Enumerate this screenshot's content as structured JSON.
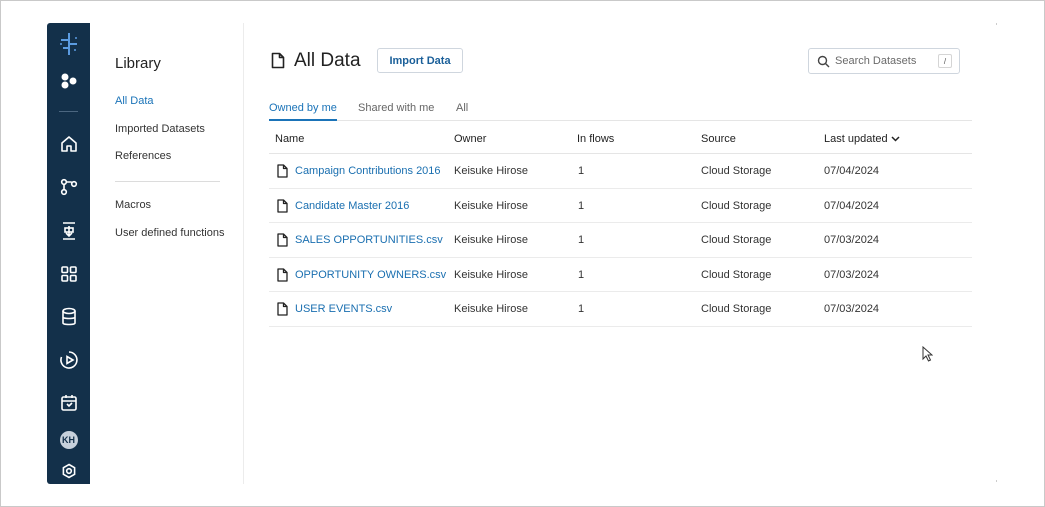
{
  "sidebar": {
    "icons": [
      "logo-icon",
      "apps-icon",
      "home-icon",
      "flow-icon",
      "transform-icon",
      "grid-icon",
      "database-icon",
      "play-icon",
      "schedule-icon",
      "avatar",
      "settings-icon"
    ],
    "avatar_initials": "KH"
  },
  "library": {
    "title": "Library",
    "items": [
      {
        "label": "All Data",
        "active": true
      },
      {
        "label": "Imported Datasets",
        "active": false
      },
      {
        "label": "References",
        "active": false
      }
    ],
    "items2": [
      {
        "label": "Macros"
      },
      {
        "label": "User defined functions"
      }
    ]
  },
  "header": {
    "title": "All Data",
    "import_label": "Import Data",
    "search_placeholder": "Search Datasets",
    "search_shortcut": "/"
  },
  "tabs": [
    {
      "label": "Owned by me",
      "active": true
    },
    {
      "label": "Shared with me",
      "active": false
    },
    {
      "label": "All",
      "active": false
    }
  ],
  "table": {
    "columns": [
      "Name",
      "Owner",
      "In flows",
      "Source",
      "Last updated"
    ],
    "rows": [
      {
        "name": "Campaign Contributions 2016",
        "owner": "Keisuke Hirose",
        "flows": "1",
        "source": "Cloud Storage",
        "updated": "07/04/2024"
      },
      {
        "name": "Candidate Master 2016",
        "owner": "Keisuke Hirose",
        "flows": "1",
        "source": "Cloud Storage",
        "updated": "07/04/2024"
      },
      {
        "name": "SALES OPPORTUNITIES.csv",
        "owner": "Keisuke Hirose",
        "flows": "1",
        "source": "Cloud Storage",
        "updated": "07/03/2024"
      },
      {
        "name": "OPPORTUNITY OWNERS.csv",
        "owner": "Keisuke Hirose",
        "flows": "1",
        "source": "Cloud Storage",
        "updated": "07/03/2024"
      },
      {
        "name": "USER EVENTS.csv",
        "owner": "Keisuke Hirose",
        "flows": "1",
        "source": "Cloud Storage",
        "updated": "07/03/2024"
      }
    ]
  },
  "colors": {
    "accent": "#1a73b8",
    "rail": "#13304a"
  }
}
